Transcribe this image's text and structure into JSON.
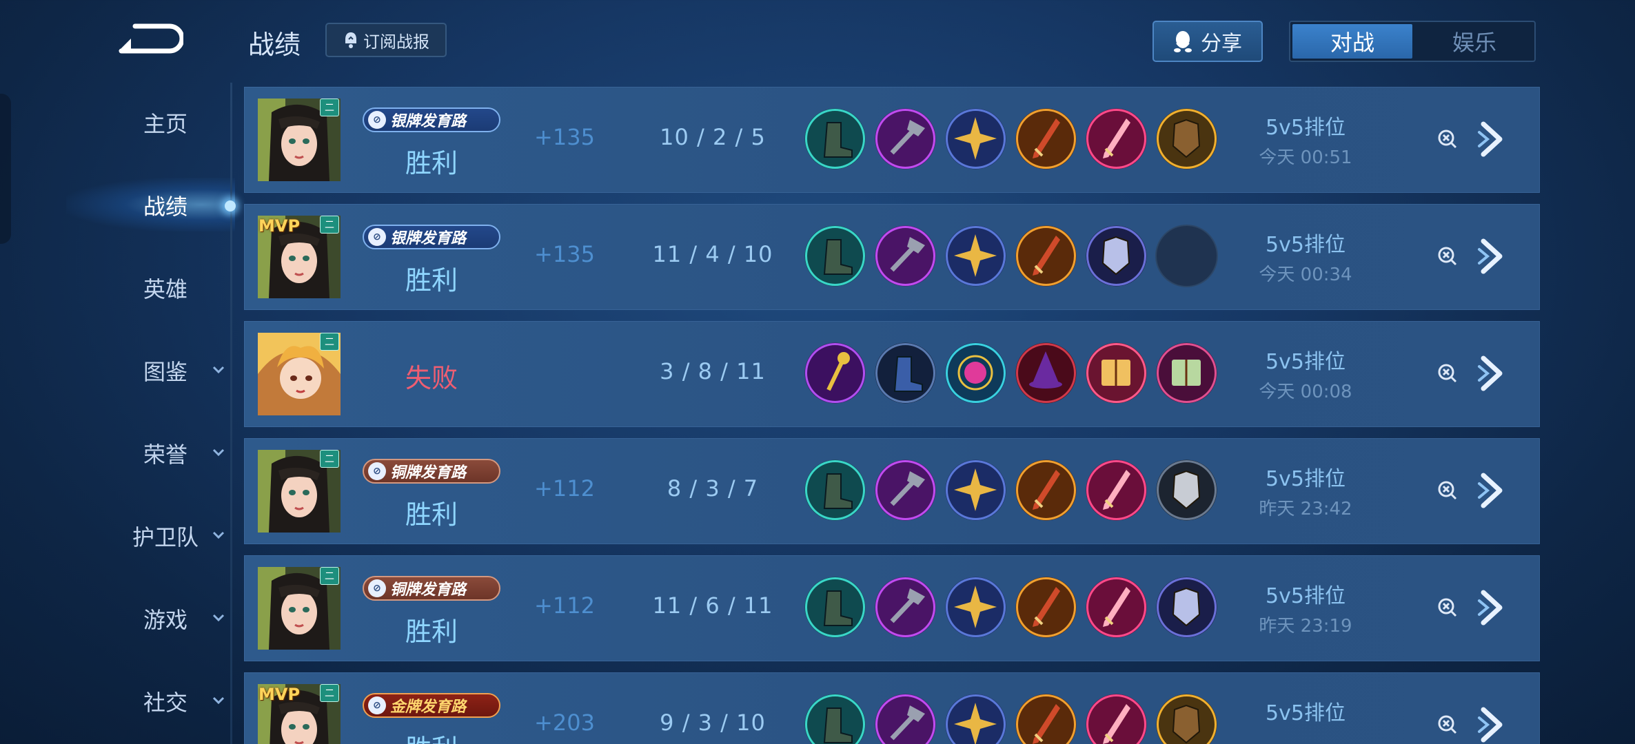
{
  "header": {
    "title": "战绩",
    "subscribe_label": "订阅战报",
    "share_label": "分享",
    "mode_tabs": [
      "对战",
      "娱乐"
    ],
    "active_mode_index": 0
  },
  "sidebar": {
    "items": [
      {
        "label": "主页",
        "expandable": false
      },
      {
        "label": "战绩",
        "expandable": false
      },
      {
        "label": "英雄",
        "expandable": false
      },
      {
        "label": "图鉴",
        "expandable": true
      },
      {
        "label": "荣誉",
        "expandable": true
      },
      {
        "label": "护卫队",
        "expandable": true
      },
      {
        "label": "游戏",
        "expandable": true
      },
      {
        "label": "社交",
        "expandable": true
      }
    ],
    "active_index": 1
  },
  "matches": [
    {
      "hero": "hero-a",
      "mvp": false,
      "level_badge": "二",
      "rank_badge": "银牌发育路",
      "rank_tier": "silver",
      "result": "胜利",
      "points": "+135",
      "kda": "10 / 2 / 5",
      "mode": "5v5排位",
      "time": "今天 00:51",
      "items": [
        "boots-item-icon",
        "axe-item-icon",
        "star-item-icon",
        "blade-item-icon",
        "pink-blade-item-icon",
        "armor-item-icon"
      ]
    },
    {
      "hero": "hero-a",
      "mvp": true,
      "mvp_label": "MVP",
      "level_badge": "二",
      "rank_badge": "银牌发育路",
      "rank_tier": "silver",
      "result": "胜利",
      "points": "+135",
      "kda": "11 / 4 / 10",
      "mode": "5v5排位",
      "time": "今天 00:34",
      "items": [
        "boots-item-icon",
        "axe-item-icon",
        "star-item-icon",
        "blade-item-icon",
        "dark-armor-item-icon",
        "empty-slot"
      ]
    },
    {
      "hero": "hero-b",
      "mvp": false,
      "level_badge": "二",
      "rank_badge": "",
      "rank_tier": "",
      "result": "失败",
      "points": "",
      "kda": "3 / 8 / 11",
      "mode": "5v5排位",
      "time": "今天 00:08",
      "items": [
        "gold-staff-item-icon",
        "blue-boots-item-icon",
        "orb-item-icon",
        "hat-item-icon",
        "book-item-icon",
        "green-book-item-icon"
      ]
    },
    {
      "hero": "hero-a",
      "mvp": false,
      "level_badge": "二",
      "rank_badge": "铜牌发育路",
      "rank_tier": "bronze",
      "result": "胜利",
      "points": "+112",
      "kda": "8 / 3 / 7",
      "mode": "5v5排位",
      "time": "昨天 23:42",
      "items": [
        "boots-item-icon",
        "axe-item-icon",
        "star-item-icon",
        "blade-item-icon",
        "pink-blade-item-icon",
        "chest-armor-item-icon"
      ]
    },
    {
      "hero": "hero-a",
      "mvp": false,
      "level_badge": "二",
      "rank_badge": "铜牌发育路",
      "rank_tier": "bronze",
      "result": "胜利",
      "points": "+112",
      "kda": "11 / 6 / 11",
      "mode": "5v5排位",
      "time": "昨天 23:19",
      "items": [
        "boots-item-icon",
        "axe-item-icon",
        "star-item-icon",
        "blade-item-icon",
        "pink-blade-item-icon",
        "dark-armor-item-icon"
      ]
    },
    {
      "hero": "hero-a",
      "mvp": true,
      "mvp_label": "MVP",
      "level_badge": "二",
      "rank_badge": "金牌发育路",
      "rank_tier": "gold",
      "result": "胜利",
      "points": "+203",
      "kda": "9 / 3 / 10",
      "mode": "5v5排位",
      "time": "",
      "items": [
        "boots-item-icon",
        "axe-item-icon",
        "star-item-icon",
        "blade-item-icon",
        "pink-blade-item-icon",
        "armor-item-icon"
      ]
    }
  ],
  "colors": {
    "win": "#8fd6ff",
    "lose": "#ee5e72",
    "points": "#4e8fd0",
    "accent": "#3b82cc"
  }
}
